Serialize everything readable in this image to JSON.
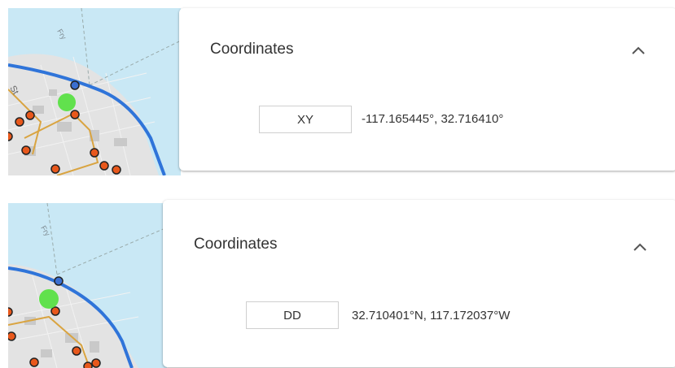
{
  "top_panel": {
    "title": "Coordinates",
    "format_label": "XY",
    "coordinate_value": "-117.165445°, 32.716410°",
    "map_labels": {
      "ferry": "Fry",
      "street": "St"
    }
  },
  "bottom_panel": {
    "title": "Coordinates",
    "format_label": "DD",
    "coordinate_value": "32.710401°N, 117.172037°W",
    "map_labels": {
      "ferry": "Fry"
    }
  },
  "colors": {
    "water": "#c9e8f5",
    "route": "#2f74d9",
    "marker_fill": "#e8581c",
    "location_dot": "#52e03c",
    "street_path": "#d9a441"
  },
  "icons": {
    "collapse": "chevron-up-icon",
    "location": "location-dot-icon"
  }
}
